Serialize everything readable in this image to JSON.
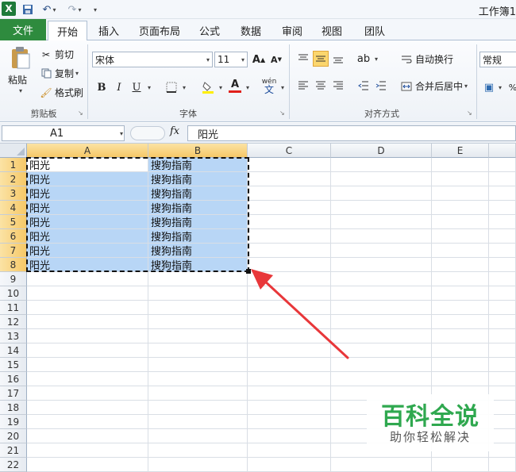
{
  "window": {
    "title": "工作簿1"
  },
  "quick_access": {
    "app_icon": "X"
  },
  "tabs": [
    "文件",
    "开始",
    "插入",
    "页面布局",
    "公式",
    "数据",
    "审阅",
    "视图",
    "团队"
  ],
  "ribbon": {
    "clipboard": {
      "paste": "粘贴",
      "cut": "剪切",
      "copy": "复制",
      "format_painter": "格式刷",
      "label": "剪贴板"
    },
    "font": {
      "name": "宋体",
      "size": "11",
      "bold": "B",
      "italic": "I",
      "underline": "U",
      "label": "字体",
      "grow": "A",
      "shrink": "A",
      "font_color": "A",
      "phonetic": "wén"
    },
    "alignment": {
      "wrap": "自动换行",
      "merge": "合并后居中",
      "label": "对齐方式"
    },
    "number": {
      "format": "常规"
    }
  },
  "formula_bar": {
    "cell_ref": "A1",
    "fx": "fx",
    "content": "阳光"
  },
  "columns": [
    "A",
    "B",
    "C",
    "D",
    "E"
  ],
  "rows": [
    "1",
    "2",
    "3",
    "4",
    "5",
    "6",
    "7",
    "8",
    "9",
    "10",
    "11",
    "12",
    "13",
    "14",
    "15",
    "16",
    "17",
    "18",
    "19",
    "20",
    "21",
    "22"
  ],
  "cells": {
    "A": [
      "阳光",
      "阳光",
      "阳光",
      "阳光",
      "阳光",
      "阳光",
      "阳光",
      "阳光"
    ],
    "B": [
      "搜狗指南",
      "搜狗指南",
      "搜狗指南",
      "搜狗指南",
      "搜狗指南",
      "搜狗指南",
      "搜狗指南",
      "搜狗指南"
    ]
  },
  "watermark": {
    "title": "百科全说",
    "subtitle": "助你轻松解决"
  },
  "colors": {
    "file_tab": "#2e8b3e",
    "selection": "#b8d6f6",
    "header_selected": "#f6c867",
    "arrow": "#e8373a",
    "watermark": "#2fa84f"
  }
}
